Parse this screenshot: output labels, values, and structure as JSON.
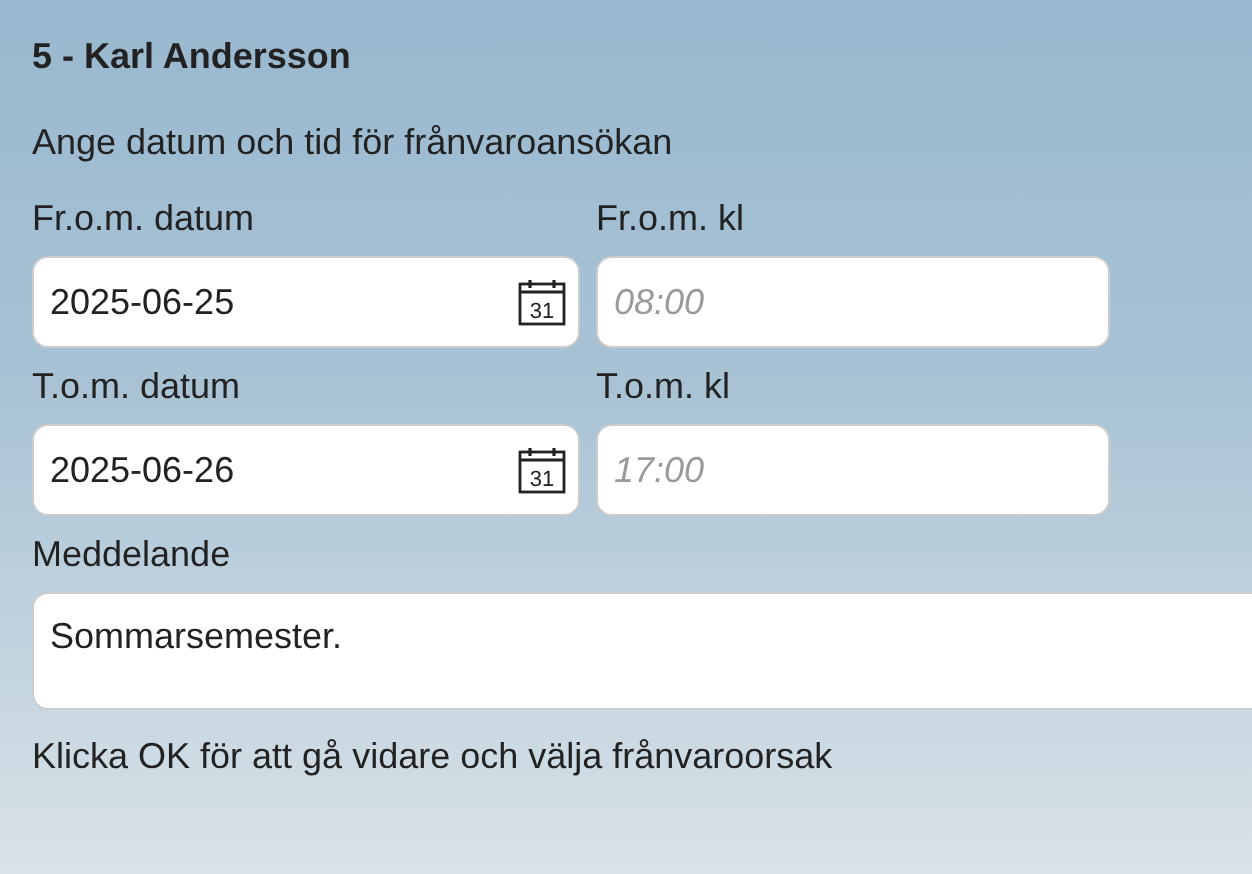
{
  "title": "5 - Karl Andersson",
  "instruction": "Ange datum och tid för frånvaroansökan",
  "rows": [
    {
      "date": {
        "label": "Fr.o.m. datum",
        "value": "2025-06-25",
        "icon_text": "31"
      },
      "time": {
        "label": "Fr.o.m. kl",
        "placeholder": "08:00"
      }
    },
    {
      "date": {
        "label": "T.o.m. datum",
        "value": "2025-06-26",
        "icon_text": "31"
      },
      "time": {
        "label": "T.o.m. kl",
        "placeholder": "17:00"
      }
    }
  ],
  "message": {
    "label": "Meddelande",
    "value": "Sommarsemester."
  },
  "footer": "Klicka OK för att gå vidare och välja frånvaroorsak"
}
